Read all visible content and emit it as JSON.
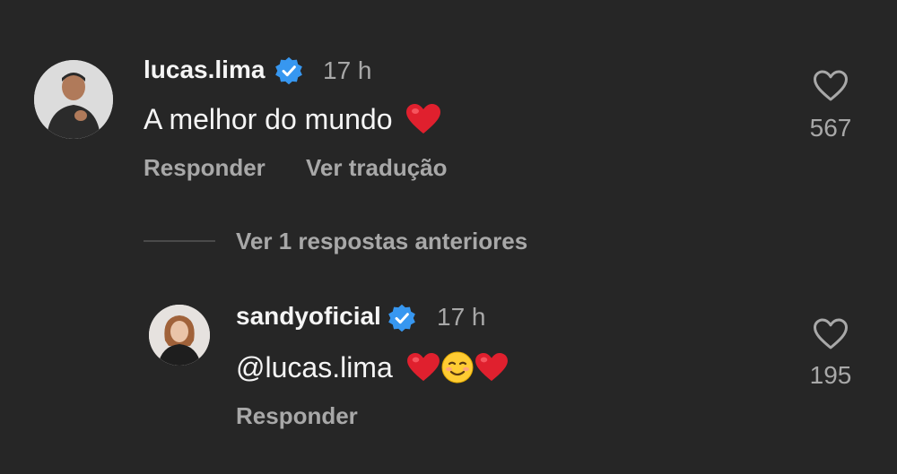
{
  "comment": {
    "username": "lucas.lima",
    "time": "17 h",
    "text": "A melhor do mundo",
    "emoji": "heart",
    "reply_label": "Responder",
    "translate_label": "Ver tradução",
    "likes": "567"
  },
  "view_replies_label": "Ver 1 respostas anteriores",
  "reply": {
    "username": "sandyoficial",
    "time": "17 h",
    "text": "@lucas.lima",
    "emojis": [
      "heart",
      "smiling-face",
      "heart"
    ],
    "reply_label": "Responder",
    "likes": "195"
  },
  "colors": {
    "background": "#262626",
    "primary_text": "#f5f5f5",
    "secondary_text": "#a8a8a8",
    "verified_badge": "#3797f0",
    "heart": "#e0202e"
  }
}
